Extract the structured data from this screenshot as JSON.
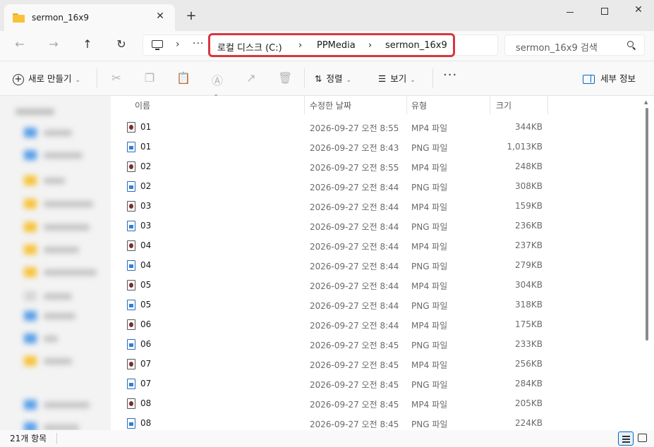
{
  "window": {
    "tab_title": "sermon_16x9",
    "tab_close": "✕",
    "new_tab": "+"
  },
  "nav": {
    "back": "←",
    "forward": "→",
    "up": "↑",
    "refresh": "↻",
    "more": "···",
    "breadcrumbs": [
      "로컬 디스크 (C:)",
      "PPMedia",
      "sermon_16x9"
    ],
    "search_placeholder": "sermon_16x9 검색"
  },
  "toolbar": {
    "new_label": "새로 만들기",
    "sort_label": "정렬",
    "view_label": "보기",
    "more": "···",
    "details_label": "세부 정보",
    "icons": [
      "cut-icon",
      "copy-icon",
      "paste-icon",
      "rename-icon",
      "share-icon",
      "delete-icon"
    ]
  },
  "columns": {
    "name": "이름",
    "date": "수정한 날짜",
    "type": "유형",
    "size": "크기"
  },
  "files": [
    {
      "name": "01",
      "kind": "mp4",
      "date": "2026-09-27 오전 8:55",
      "type": "MP4 파일",
      "size": "344KB"
    },
    {
      "name": "01",
      "kind": "png",
      "date": "2026-09-27 오전 8:43",
      "type": "PNG 파일",
      "size": "1,013KB"
    },
    {
      "name": "02",
      "kind": "mp4",
      "date": "2026-09-27 오전 8:55",
      "type": "MP4 파일",
      "size": "248KB"
    },
    {
      "name": "02",
      "kind": "png",
      "date": "2026-09-27 오전 8:44",
      "type": "PNG 파일",
      "size": "308KB"
    },
    {
      "name": "03",
      "kind": "mp4",
      "date": "2026-09-27 오전 8:44",
      "type": "MP4 파일",
      "size": "159KB"
    },
    {
      "name": "03",
      "kind": "png",
      "date": "2026-09-27 오전 8:44",
      "type": "PNG 파일",
      "size": "236KB"
    },
    {
      "name": "04",
      "kind": "mp4",
      "date": "2026-09-27 오전 8:44",
      "type": "MP4 파일",
      "size": "237KB"
    },
    {
      "name": "04",
      "kind": "png",
      "date": "2026-09-27 오전 8:44",
      "type": "PNG 파일",
      "size": "279KB"
    },
    {
      "name": "05",
      "kind": "mp4",
      "date": "2026-09-27 오전 8:44",
      "type": "MP4 파일",
      "size": "304KB"
    },
    {
      "name": "05",
      "kind": "png",
      "date": "2026-09-27 오전 8:44",
      "type": "PNG 파일",
      "size": "318KB"
    },
    {
      "name": "06",
      "kind": "mp4",
      "date": "2026-09-27 오전 8:44",
      "type": "MP4 파일",
      "size": "175KB"
    },
    {
      "name": "06",
      "kind": "png",
      "date": "2026-09-27 오전 8:45",
      "type": "PNG 파일",
      "size": "233KB"
    },
    {
      "name": "07",
      "kind": "mp4",
      "date": "2026-09-27 오전 8:45",
      "type": "MP4 파일",
      "size": "256KB"
    },
    {
      "name": "07",
      "kind": "png",
      "date": "2026-09-27 오전 8:45",
      "type": "PNG 파일",
      "size": "284KB"
    },
    {
      "name": "08",
      "kind": "mp4",
      "date": "2026-09-27 오전 8:45",
      "type": "MP4 파일",
      "size": "205KB"
    },
    {
      "name": "08",
      "kind": "png",
      "date": "2026-09-27 오전 8:45",
      "type": "PNG 파일",
      "size": "224KB"
    }
  ],
  "status": {
    "item_count": "21개 항목"
  },
  "colors": {
    "accent": "#0067c0",
    "highlight_border": "#d9363e",
    "folder": "#f8c33a"
  }
}
